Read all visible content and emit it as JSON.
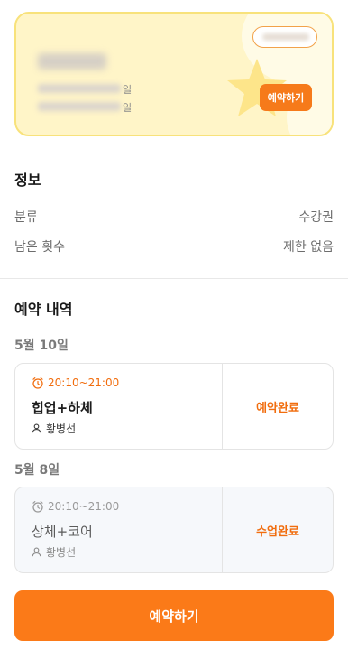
{
  "pass": {
    "name": "",
    "tick1": "일",
    "tick2": "일",
    "reserve_label": "예약하기"
  },
  "info": {
    "title": "정보",
    "rows": [
      {
        "label": "분류",
        "value": "수강권"
      },
      {
        "label": "남은 횟수",
        "value": "제한 없음"
      }
    ]
  },
  "reservations": {
    "title": "예약 내역",
    "groups": [
      {
        "date": "5월 10일",
        "time": "20:10~21:00",
        "class": "힙업+하체",
        "instructor": "황병선",
        "status": "예약완료"
      },
      {
        "date": "5월 8일",
        "time": "20:10~21:00",
        "class": "상체+코어",
        "instructor": "황병선",
        "status": "수업완료"
      }
    ]
  },
  "cta_label": "예약하기",
  "colors": {
    "accent": "#fb7a18",
    "card_bg": "#fff5c8",
    "card_border": "#f8e27b"
  },
  "icons": {
    "clock": "alarm-clock-icon",
    "person": "person-icon"
  }
}
